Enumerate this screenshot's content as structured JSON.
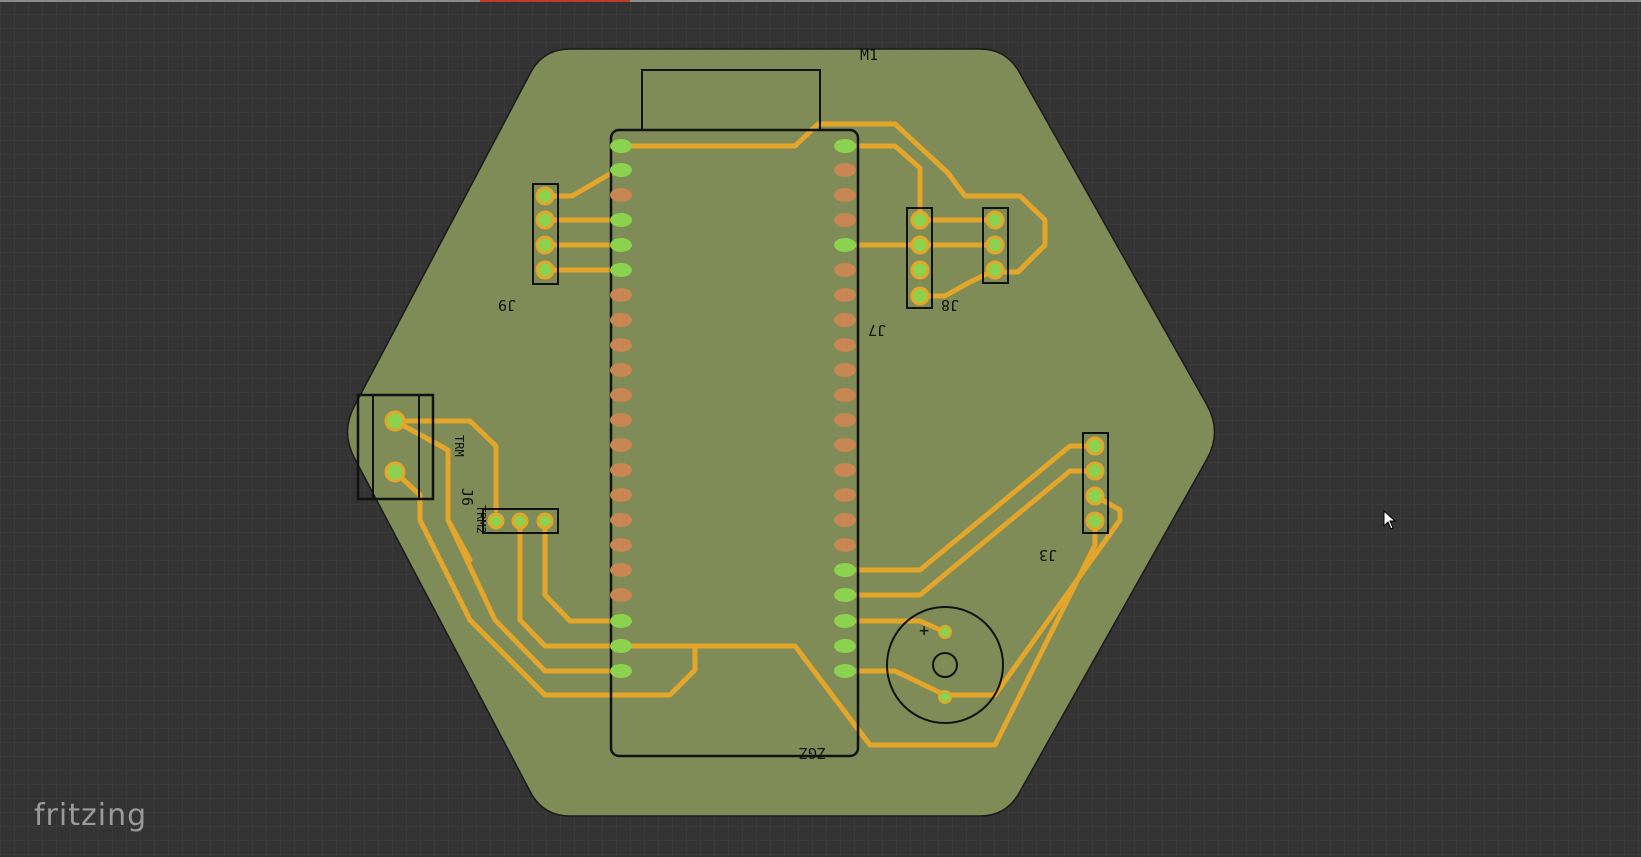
{
  "app": {
    "logo_text": "fritzing"
  },
  "pcb": {
    "board_color": "#7f8c57",
    "trace_color": "#e3a62a",
    "pad_color": "#8bd24f",
    "pad_inactive_color": "#c88653",
    "labels": {
      "m1": "M1",
      "j9": "J9",
      "j7": "J7",
      "j8": "J8",
      "j6": "J6",
      "j3": "J3",
      "trm": "TRM",
      "trm2": "TRM2",
      "esp": "ZGZ",
      "buzzer_plus": "+"
    }
  },
  "cursor": {
    "icon": "arrow-cursor-icon"
  }
}
